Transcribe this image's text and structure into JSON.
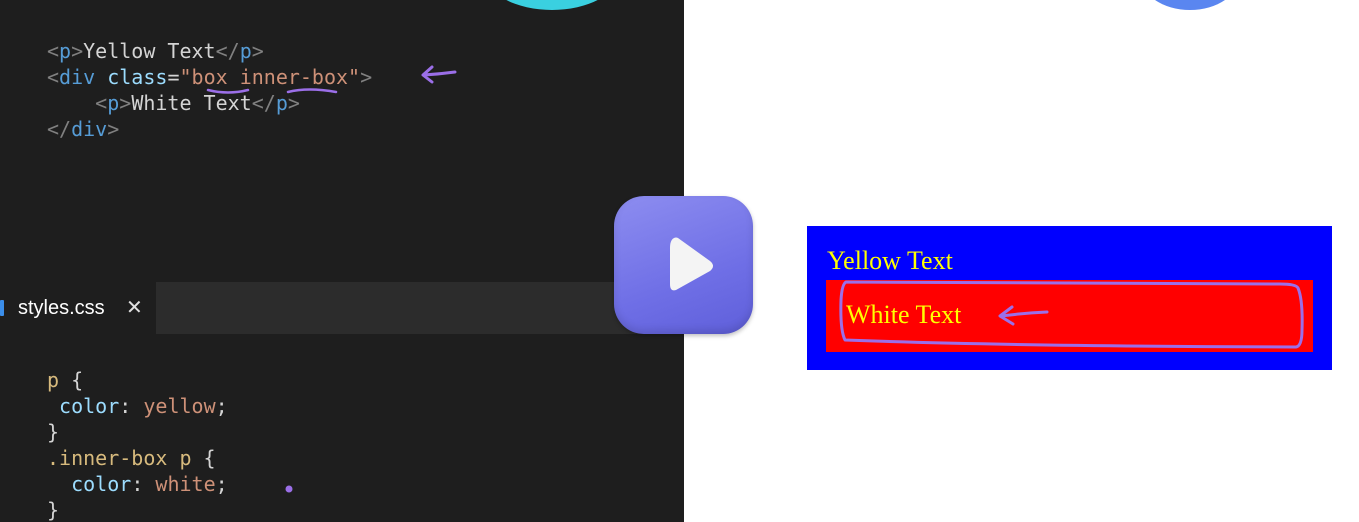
{
  "editor": {
    "html_lines": [
      {
        "parts": [
          [
            "tag-b",
            "<"
          ],
          [
            "tag-n",
            "p"
          ],
          [
            "tag-b",
            ">"
          ],
          [
            "txt",
            "Yellow Text"
          ],
          [
            "tag-b",
            "</"
          ],
          [
            "tag-n",
            "p"
          ],
          [
            "tag-b",
            ">"
          ]
        ]
      },
      {
        "parts": [
          [
            "tag-b",
            "<"
          ],
          [
            "tag-n",
            "div"
          ],
          [
            "txt",
            " "
          ],
          [
            "attr",
            "class"
          ],
          [
            "txt",
            "="
          ],
          [
            "str",
            "\"box inner-box\""
          ],
          [
            "tag-b",
            ">"
          ]
        ]
      },
      {
        "parts": [
          [
            "txt",
            "    "
          ],
          [
            "tag-b",
            "<"
          ],
          [
            "tag-n",
            "p"
          ],
          [
            "tag-b",
            ">"
          ],
          [
            "txt",
            "White Text"
          ],
          [
            "tag-b",
            "</"
          ],
          [
            "tag-n",
            "p"
          ],
          [
            "tag-b",
            ">"
          ]
        ]
      },
      {
        "parts": [
          [
            "tag-b",
            "</"
          ],
          [
            "tag-n",
            "div"
          ],
          [
            "tag-b",
            ">"
          ]
        ]
      }
    ],
    "tab": {
      "label": "styles.css",
      "close": "✕"
    },
    "css_lines": [
      {
        "parts": [
          [
            "sel",
            "p"
          ],
          [
            "punc",
            " {"
          ]
        ]
      },
      {
        "parts": [
          [
            "txt",
            " "
          ],
          [
            "prop",
            "color"
          ],
          [
            "punc",
            ": "
          ],
          [
            "val",
            "yellow"
          ],
          [
            "punc",
            ";"
          ]
        ]
      },
      {
        "parts": [
          [
            "punc",
            "}"
          ]
        ]
      },
      {
        "parts": [
          [
            "sel",
            ".inner-box p"
          ],
          [
            "punc",
            " {"
          ]
        ]
      },
      {
        "parts": [
          [
            "txt",
            "  "
          ],
          [
            "prop",
            "color"
          ],
          [
            "punc",
            ": "
          ],
          [
            "val",
            "white"
          ],
          [
            "punc",
            ";"
          ]
        ]
      },
      {
        "parts": [
          [
            "punc",
            "}"
          ]
        ]
      }
    ]
  },
  "play_button": {
    "icon": "play-icon"
  },
  "preview": {
    "yellow_text": "Yellow Text",
    "white_text": "White Text",
    "outer_color": "#0000ff",
    "inner_color": "#ff0000",
    "text_color": "#ffff00"
  },
  "annotations": {
    "color": "#9b6fe8"
  }
}
